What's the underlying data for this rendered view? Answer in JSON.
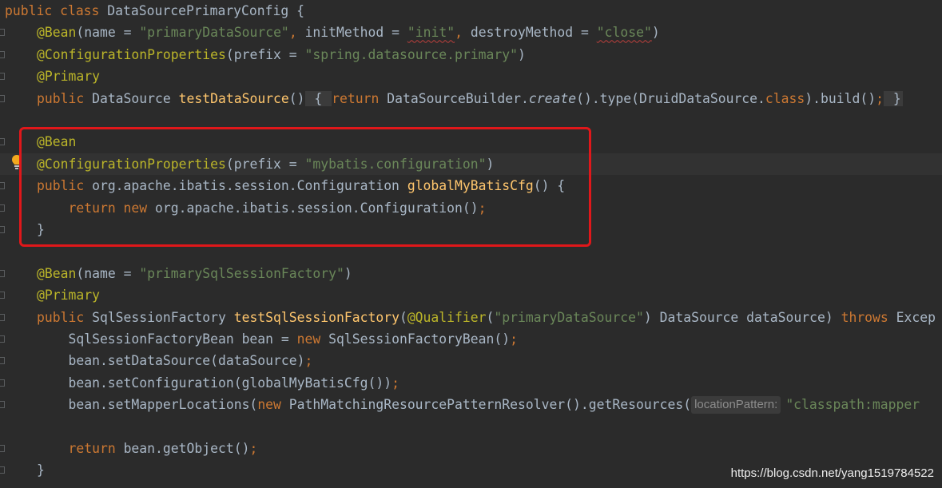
{
  "editor": {
    "lines": [
      [
        [
          "kw",
          "public "
        ],
        [
          "kw",
          "class "
        ],
        [
          "plain",
          "DataSourcePrimaryConfig {"
        ]
      ],
      [
        [
          "ann",
          "@Bean"
        ],
        [
          "plain",
          "("
        ],
        [
          "param",
          "name"
        ],
        [
          "plain",
          " = "
        ],
        [
          "str",
          "\"primaryDataSource\""
        ],
        [
          "kw",
          ", "
        ],
        [
          "param",
          "initMethod"
        ],
        [
          "plain",
          " = "
        ],
        [
          "strsq",
          "\"init\""
        ],
        [
          "kw",
          ", "
        ],
        [
          "param",
          "destroyMethod"
        ],
        [
          "plain",
          " = "
        ],
        [
          "strsq",
          "\"close\""
        ],
        [
          "plain",
          ")"
        ]
      ],
      [
        [
          "ann",
          "@ConfigurationProperties"
        ],
        [
          "plain",
          "("
        ],
        [
          "param",
          "prefix"
        ],
        [
          "plain",
          " = "
        ],
        [
          "str",
          "\"spring.datasource.primary\""
        ],
        [
          "plain",
          ")"
        ]
      ],
      [
        [
          "ann",
          "@Primary"
        ]
      ],
      [
        [
          "kw",
          "public "
        ],
        [
          "plain",
          "DataSource "
        ],
        [
          "fn",
          "testDataSource"
        ],
        [
          "plain",
          "()"
        ],
        [
          "fold",
          " { "
        ],
        [
          "kw",
          "return "
        ],
        [
          "plain",
          "DataSourceBuilder."
        ],
        [
          "it",
          "create"
        ],
        [
          "plain",
          "().type(DruidDataSource."
        ],
        [
          "kw",
          "class"
        ],
        [
          "plain",
          ").build()"
        ],
        [
          "kw",
          ";"
        ],
        [
          "fold",
          " }"
        ]
      ],
      [],
      [
        [
          "ann",
          "@Bean"
        ]
      ],
      [
        [
          "ann",
          "@ConfigurationProperties"
        ],
        [
          "plain",
          "("
        ],
        [
          "param",
          "prefix"
        ],
        [
          "plain",
          " = "
        ],
        [
          "str",
          "\"mybatis.configuration\""
        ],
        [
          "plain",
          ")"
        ]
      ],
      [
        [
          "kw",
          "public "
        ],
        [
          "plain",
          "org.apache.ibatis.session.Configuration "
        ],
        [
          "fn",
          "globalMyBatisCfg"
        ],
        [
          "plain",
          "() {"
        ]
      ],
      [
        [
          "plain",
          "    "
        ],
        [
          "kw",
          "return new "
        ],
        [
          "plain",
          "org.apache.ibatis.session.Configuration()"
        ],
        [
          "kw",
          ";"
        ]
      ],
      [
        [
          "plain",
          "}"
        ]
      ],
      [],
      [
        [
          "ann",
          "@Bean"
        ],
        [
          "plain",
          "("
        ],
        [
          "param",
          "name"
        ],
        [
          "plain",
          " = "
        ],
        [
          "str",
          "\"primarySqlSessionFactory\""
        ],
        [
          "plain",
          ")"
        ]
      ],
      [
        [
          "ann",
          "@Primary"
        ]
      ],
      [
        [
          "kw",
          "public "
        ],
        [
          "plain",
          "SqlSessionFactory "
        ],
        [
          "fn",
          "testSqlSessionFactory"
        ],
        [
          "plain",
          "("
        ],
        [
          "ann",
          "@Qualifier"
        ],
        [
          "plain",
          "("
        ],
        [
          "str",
          "\"primaryDataSource\""
        ],
        [
          "plain",
          ") DataSource dataSource) "
        ],
        [
          "kw",
          "throws "
        ],
        [
          "plain",
          "Excep"
        ]
      ],
      [
        [
          "plain",
          "    SqlSessionFactoryBean bean = "
        ],
        [
          "kw",
          "new "
        ],
        [
          "plain",
          "SqlSessionFactoryBean()"
        ],
        [
          "kw",
          ";"
        ]
      ],
      [
        [
          "plain",
          "    bean.setDataSource(dataSource)"
        ],
        [
          "kw",
          ";"
        ]
      ],
      [
        [
          "plain",
          "    bean.setConfiguration(globalMyBatisCfg())"
        ],
        [
          "kw",
          ";"
        ]
      ],
      [
        [
          "plain",
          "    bean.setMapperLocations("
        ],
        [
          "kw",
          "new "
        ],
        [
          "plain",
          "PathMatchingResourcePatternResolver().getResources("
        ],
        [
          "hint",
          "locationPattern:"
        ],
        [
          "str",
          "\"classpath:mapper"
        ]
      ],
      [],
      [
        [
          "plain",
          "    "
        ],
        [
          "kw",
          "return "
        ],
        [
          "plain",
          "bean.getObject()"
        ],
        [
          "kw",
          ";"
        ]
      ],
      [
        [
          "plain",
          "}"
        ]
      ]
    ],
    "indent_level": [
      0,
      1,
      1,
      1,
      1,
      0,
      1,
      1,
      1,
      1,
      1,
      0,
      1,
      1,
      1,
      1,
      1,
      1,
      1,
      0,
      1,
      1
    ],
    "caret_line": 7,
    "highlight_label": "highlighted-bean-block"
  },
  "watermark": "https://blog.csdn.net/yang1519784522",
  "colors": {
    "background": "#2b2b2b",
    "keyword": "#cc7832",
    "annotation": "#bbb529",
    "string": "#6a8759",
    "method": "#ffc66d",
    "plain": "#a9b7c6",
    "highlight_border": "#e0171a"
  },
  "icons": {
    "gutter_bulb": "lightbulb-icon",
    "fold": "fold-marker-icon"
  }
}
